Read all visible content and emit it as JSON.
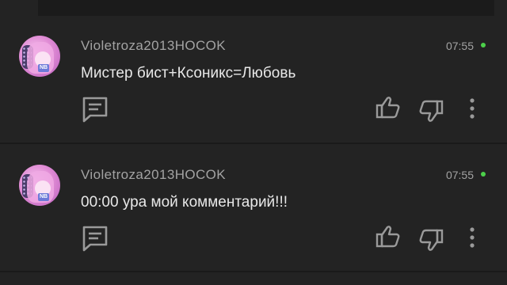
{
  "comments": [
    {
      "username": "Violetroza2013HOCOK",
      "time": "07:55",
      "text": "Мистер бист+Ксоникс=Любовь",
      "avatar_badge": "NB",
      "online": true
    },
    {
      "username": "Violetroza2013HOCOK",
      "time": "07:55",
      "text": "00:00 ура мой комментарий!!!",
      "avatar_badge": "NB",
      "online": true
    }
  ],
  "icons": {
    "reply": "reply-comment-icon",
    "like": "thumbs-up-icon",
    "dislike": "thumbs-down-icon",
    "more": "more-vertical-icon"
  },
  "colors": {
    "background": "#232323",
    "username": "#a3a3a3",
    "text": "#e8e8e8",
    "icon": "#9a9a9a",
    "online": "#4cd04a"
  }
}
